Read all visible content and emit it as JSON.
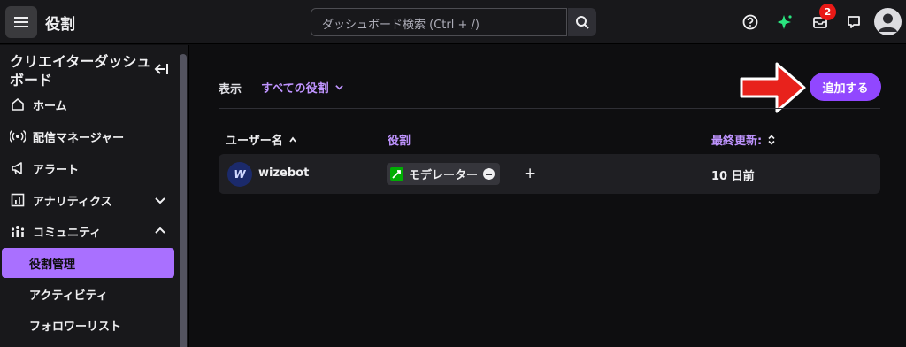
{
  "header": {
    "title": "役割",
    "search_placeholder": "ダッシュボード検索 (Ctrl + /)",
    "notification_count": "2"
  },
  "sidebar": {
    "title": "クリエイターダッシュボード",
    "items": [
      {
        "label": "ホーム",
        "icon": "home-icon"
      },
      {
        "label": "配信マネージャー",
        "icon": "broadcast-icon"
      },
      {
        "label": "アラート",
        "icon": "megaphone-icon"
      },
      {
        "label": "アナリティクス",
        "icon": "analytics-icon"
      },
      {
        "label": "コミュニティ",
        "icon": "community-icon"
      }
    ],
    "sub_items": [
      {
        "label": "役割管理",
        "active": true
      },
      {
        "label": "アクティビティ",
        "active": false
      },
      {
        "label": "フォロワーリスト",
        "active": false
      }
    ]
  },
  "main": {
    "filter_label": "表示",
    "filter_value": "すべての役割",
    "add_button": "追加する",
    "columns": {
      "username": "ユーザー名",
      "role": "役割",
      "updated": "最終更新:"
    },
    "rows": [
      {
        "username": "wizebot",
        "avatar_letter": "W",
        "role": "モデレーター",
        "updated": "10 日前"
      }
    ]
  },
  "colors": {
    "accent": "#9147ff",
    "accent_light": "#bf94ff",
    "moderator": "#00ad03",
    "annotation_arrow": "#e8221c"
  }
}
